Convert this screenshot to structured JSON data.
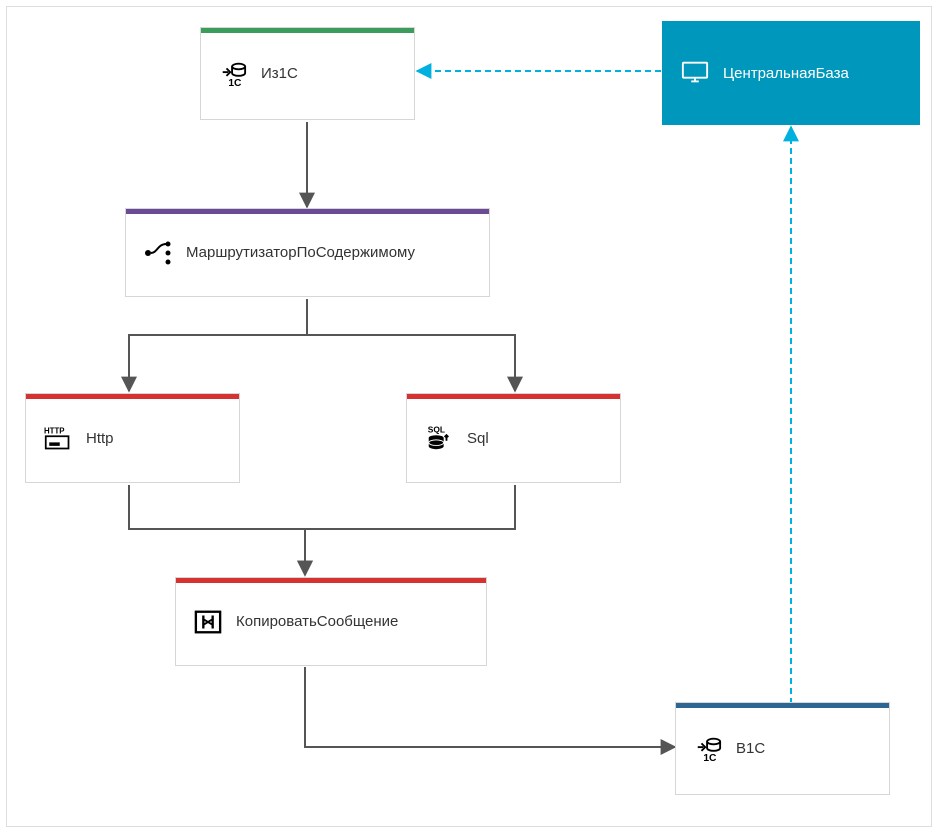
{
  "nodes": {
    "iz1c": {
      "label": "Из1С",
      "color": "#3c9c5b"
    },
    "central": {
      "label": "ЦентральнаяБаза",
      "color": "#0097bc"
    },
    "router": {
      "label": "МаршрутизаторПоСодержимому",
      "color": "#6b4a96"
    },
    "http": {
      "label": "Http",
      "color": "#d73232"
    },
    "sql": {
      "label": "Sql",
      "color": "#d73232"
    },
    "copy": {
      "label": "КопироватьСообщение",
      "color": "#d73232"
    },
    "v1c": {
      "label": "В1С",
      "color": "#2d6593"
    }
  },
  "edges": [
    {
      "from": "iz1c",
      "to": "router",
      "style": "solid",
      "color": "#555"
    },
    {
      "from": "router",
      "to": "http",
      "style": "solid",
      "color": "#555"
    },
    {
      "from": "router",
      "to": "sql",
      "style": "solid",
      "color": "#555"
    },
    {
      "from": "http",
      "to": "copy",
      "style": "solid",
      "color": "#555"
    },
    {
      "from": "sql",
      "to": "copy",
      "style": "solid",
      "color": "#555"
    },
    {
      "from": "copy",
      "to": "v1c",
      "style": "solid",
      "color": "#555"
    },
    {
      "from": "central",
      "to": "iz1c",
      "style": "dashed",
      "color": "#00b0df"
    },
    {
      "from": "v1c",
      "to": "central",
      "style": "dashed",
      "color": "#00b0df"
    }
  ]
}
